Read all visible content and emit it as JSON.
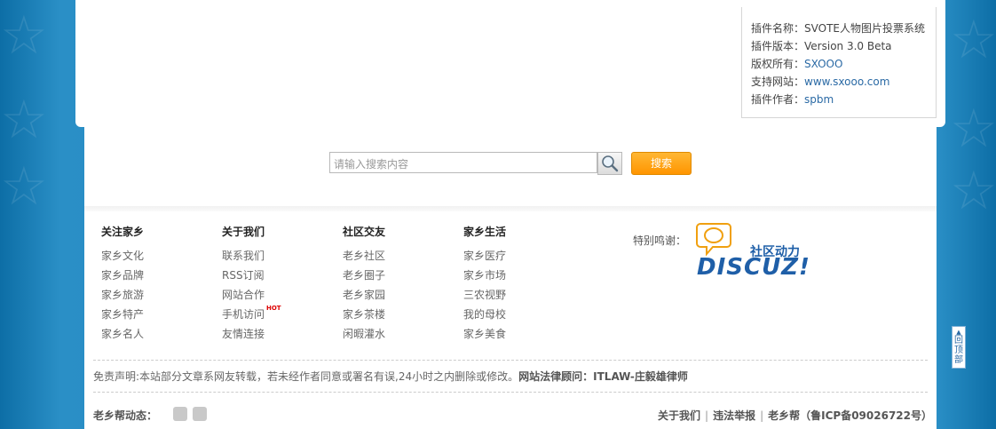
{
  "plugin_info": {
    "name_label": "插件名称：",
    "name_value": "SVOTE人物图片投票系统",
    "version_label": "插件版本：",
    "version_value": "Version 3.0 Beta",
    "copyright_label": "版权所有：",
    "copyright_value": "SXOOO",
    "website_label": "支持网站：",
    "website_value": "www.sxooo.com",
    "author_label": "插件作者：",
    "author_value": "spbm"
  },
  "search": {
    "placeholder": "请输入搜索内容",
    "button_label": "搜索"
  },
  "footer_columns": [
    {
      "title": "关注家乡",
      "links": [
        "家乡文化",
        "家乡品牌",
        "家乡旅游",
        "家乡特产",
        "家乡名人"
      ]
    },
    {
      "title": "关于我们",
      "links": [
        "联系我们",
        "RSS订阅",
        "网站合作",
        "手机访问",
        "友情连接"
      ]
    },
    {
      "title": "社区交友",
      "links": [
        "老乡社区",
        "老乡圈子",
        "老乡家园",
        "家乡茶楼",
        "闲暇灌水"
      ]
    },
    {
      "title": "家乡生活",
      "links": [
        "家乡医疗",
        "家乡市场",
        "三农视野",
        "我的母校",
        "家乡美食"
      ]
    }
  ],
  "hot_badge": "HOT",
  "thanks_label": "特别鸣谢：",
  "discuz": {
    "cn": "社区动力",
    "en": "DISCUZ!"
  },
  "disclaimer": {
    "text": "免责声明:本站部分文章系网友转载，若未经作者同意或署名有误,24小时之内删除或修改。",
    "legal": "网站法律顾问：ITLAW-庄毅雄律师"
  },
  "dynamics_label": "老乡帮动态：",
  "bottom_links": {
    "about": "关于我们",
    "report": "违法举报",
    "site": "老乡帮（鲁ICP备09026722号）",
    "sep": "|"
  },
  "back_to_top": "回顶部",
  "colors": {
    "background": "#1b7fb8",
    "accent_orange": "#ff9500",
    "link_blue": "#2b6aa5"
  }
}
